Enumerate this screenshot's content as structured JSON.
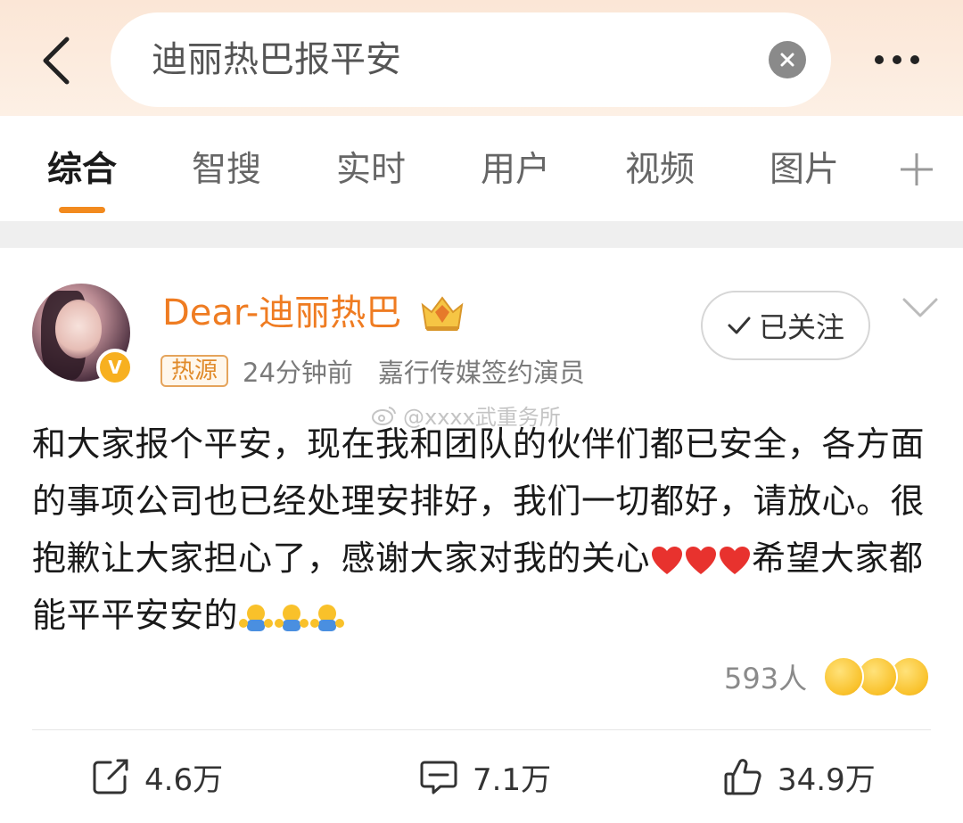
{
  "search": {
    "query": "迪丽热巴报平安"
  },
  "tabs": [
    {
      "label": "综合",
      "active": true
    },
    {
      "label": "智搜",
      "active": false
    },
    {
      "label": "实时",
      "active": false
    },
    {
      "label": "用户",
      "active": false
    },
    {
      "label": "视频",
      "active": false
    },
    {
      "label": "图片",
      "active": false
    }
  ],
  "post": {
    "username": "Dear-迪丽热巴",
    "follow_label": "已关注",
    "hot_tag": "热源",
    "time": "24分钟前",
    "description": "嘉行传媒签约演员",
    "watermark": "@xxxx武重务所",
    "text_line1": "和大家报个平安，现在我和团队的伙伴们都已安全，各方面的事项公司也已经处理安排好，我们一切都好，请放心。很抱歉让大家担心了，感谢大家对我的关心",
    "text_line2": "希望大家都能平平安安的",
    "reaction_count": "593人",
    "reposts": "4.6万",
    "comments": "7.1万",
    "likes": "34.9万"
  },
  "colors": {
    "accent": "#f28a1e",
    "username": "#ef7c22",
    "heart": "#e8322e"
  }
}
